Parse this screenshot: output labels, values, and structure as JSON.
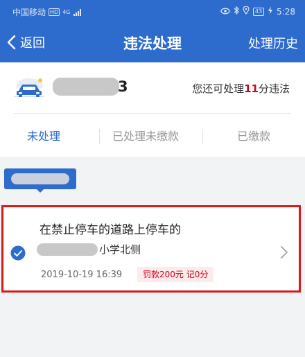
{
  "status_bar": {
    "carrier": "中国移动",
    "hd_badge": "HD",
    "network": "4G",
    "battery_level": "43",
    "time": "5:28"
  },
  "nav": {
    "back_label": "返回",
    "title": "违法处理",
    "history_label": "处理历史"
  },
  "vehicle": {
    "plate_tail": "3",
    "points_prefix": "您还可处理",
    "points_value": "11",
    "points_suffix": "分违法"
  },
  "tabs": [
    {
      "label": "未处理",
      "active": true
    },
    {
      "label": "已处理未缴款",
      "active": false
    },
    {
      "label": "已缴款",
      "active": false
    }
  ],
  "violation": {
    "title": "在禁止停车的道路上停车的",
    "location_tail": "小学北侧",
    "time": "2019-10-19 16:39",
    "fine": "罚款200元 记0分"
  },
  "colors": {
    "brand": "#2d6ccc",
    "accent_red": "#d0021b",
    "highlight_border": "#d71a1a"
  }
}
